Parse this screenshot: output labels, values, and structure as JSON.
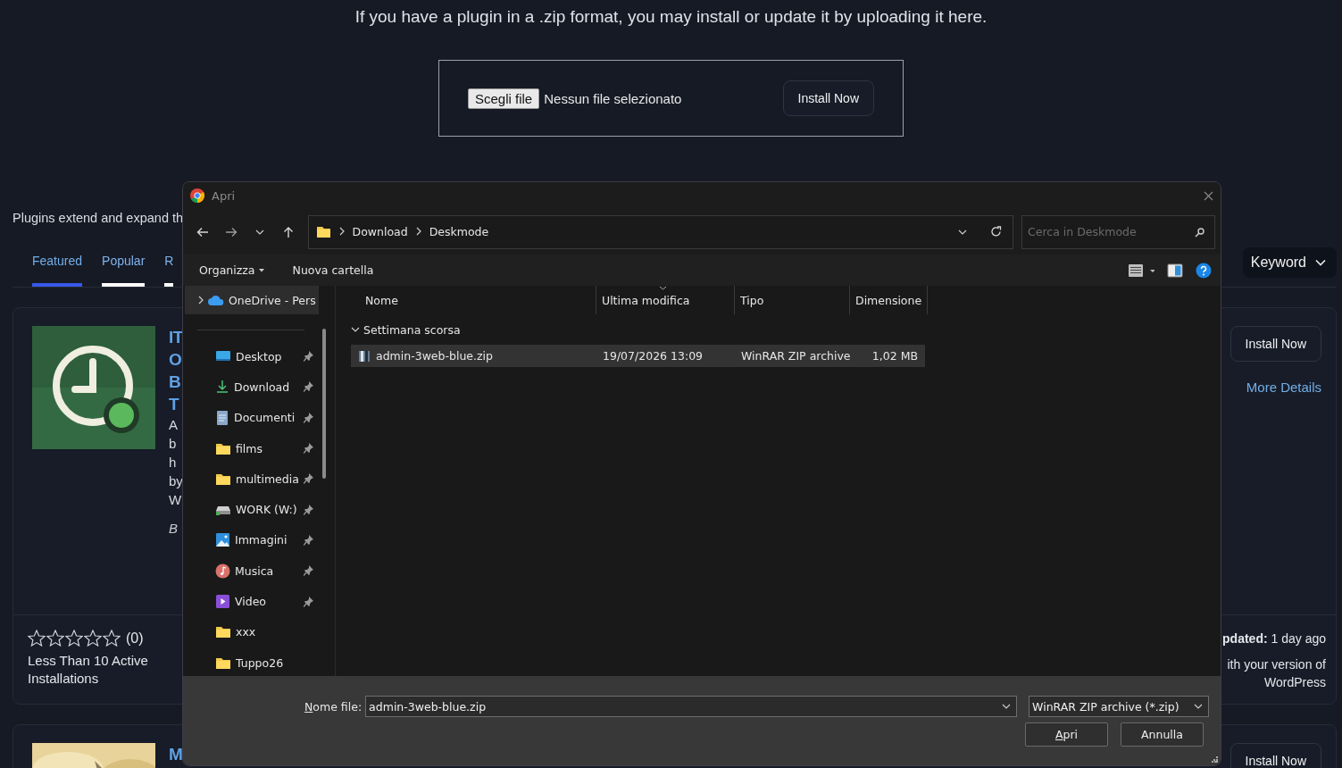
{
  "intro": "If you have a plugin in a .zip format, you may install or update it by uploading it here.",
  "upload": {
    "choose_button": "Scegli file",
    "file_status": "Nessun file selezionato",
    "install_button": "Install Now"
  },
  "description": "Plugins extend and expand th",
  "tabs": [
    {
      "label": "Featured",
      "selected": true
    },
    {
      "label": "Popular",
      "selected": false
    },
    {
      "label": "R",
      "selected": false
    }
  ],
  "search_type": "Keyword",
  "cards": [
    {
      "title_lines": [
        "IT",
        "O",
        "B",
        "T"
      ],
      "description_lines": [
        "A",
        "b",
        "h",
        "by",
        "W"
      ],
      "author": "B",
      "install_button": "Install Now",
      "details_link": "More Details",
      "stars": 0,
      "rating_count": "(0)",
      "installs": "Less Than 10 Active Installations",
      "updated": "**pdated:** 1 day ago",
      "compatibility": "ith your version of WordPress"
    },
    {
      "title_lines": [
        "M"
      ],
      "install_button": "Install Now"
    }
  ],
  "dialog": {
    "title": "Apri",
    "path": [
      "Download",
      "Deskmode"
    ],
    "search": {
      "placeholder": "Cerca in Deskmode"
    },
    "toolbar": {
      "organize": "Organizza",
      "new_folder": "Nuova cartella"
    },
    "nav_items": [
      {
        "label": "OneDrive - Pers",
        "kind": "cloud",
        "pinned": false,
        "selected": true,
        "expanded": false
      },
      {
        "label": "Desktop",
        "kind": "desktop",
        "pinned": true,
        "selected": false
      },
      {
        "label": "Download",
        "kind": "download",
        "pinned": true,
        "selected": false
      },
      {
        "label": "Documenti",
        "kind": "document",
        "pinned": true,
        "selected": false
      },
      {
        "label": "films",
        "kind": "folder",
        "pinned": true,
        "selected": false
      },
      {
        "label": "multimedia",
        "kind": "folder",
        "pinned": true,
        "selected": false
      },
      {
        "label": "WORK (W:)",
        "kind": "drive",
        "pinned": true,
        "selected": false
      },
      {
        "label": "Immagini",
        "kind": "pictures",
        "pinned": true,
        "selected": false
      },
      {
        "label": "Musica",
        "kind": "music",
        "pinned": true,
        "selected": false
      },
      {
        "label": "Video",
        "kind": "video",
        "pinned": true,
        "selected": false
      },
      {
        "label": "xxx",
        "kind": "folder",
        "pinned": false,
        "selected": false
      },
      {
        "label": "Tuppo26",
        "kind": "folder",
        "pinned": false,
        "selected": false
      }
    ],
    "columns": [
      {
        "label": "Nome",
        "sorted": false
      },
      {
        "label": "Ultima modifica",
        "sorted": true
      },
      {
        "label": "Tipo",
        "sorted": false
      },
      {
        "label": "Dimensione",
        "sorted": false
      }
    ],
    "groups": [
      {
        "label": "Settimana scorsa",
        "expanded": true,
        "files": [
          {
            "name": "admin-3web-blue.zip",
            "modified": "19/07/2026 13:09",
            "type": "WinRAR ZIP archive",
            "size": "1,02 MB",
            "selected": true
          }
        ]
      }
    ],
    "file_name_label": "Nome file:",
    "file_name": "admin-3web-blue.zip",
    "file_type": "WinRAR ZIP archive (*.zip)",
    "open_button": "Apri",
    "cancel_button": "Annulla"
  }
}
